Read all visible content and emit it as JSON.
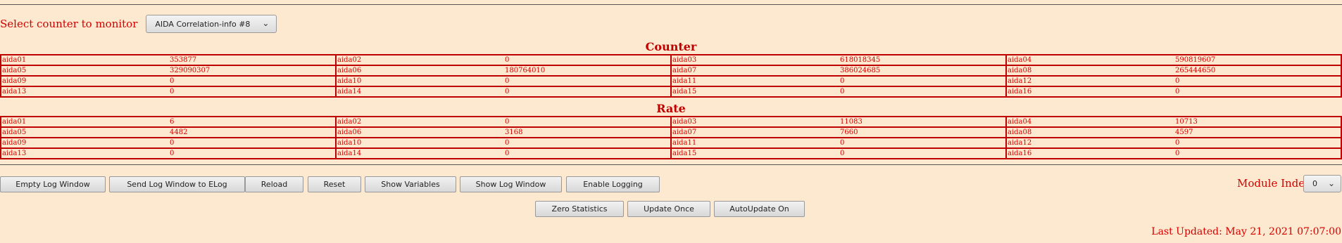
{
  "selector": {
    "label": "Select counter to monitor",
    "selected": "AIDA Correlation-info #8"
  },
  "counter": {
    "title": "Counter",
    "rows": [
      [
        {
          "name": "aida01",
          "value": "353877"
        },
        {
          "name": "aida02",
          "value": "0"
        },
        {
          "name": "aida03",
          "value": "618018345"
        },
        {
          "name": "aida04",
          "value": "590819607"
        }
      ],
      [
        {
          "name": "aida05",
          "value": "329090307"
        },
        {
          "name": "aida06",
          "value": "180764010"
        },
        {
          "name": "aida07",
          "value": "386024685"
        },
        {
          "name": "aida08",
          "value": "265444650"
        }
      ],
      [
        {
          "name": "aida09",
          "value": "0"
        },
        {
          "name": "aida10",
          "value": "0"
        },
        {
          "name": "aida11",
          "value": "0"
        },
        {
          "name": "aida12",
          "value": "0"
        }
      ],
      [
        {
          "name": "aida13",
          "value": "0"
        },
        {
          "name": "aida14",
          "value": "0"
        },
        {
          "name": "aida15",
          "value": "0"
        },
        {
          "name": "aida16",
          "value": "0"
        }
      ]
    ]
  },
  "rate": {
    "title": "Rate",
    "rows": [
      [
        {
          "name": "aida01",
          "value": "6"
        },
        {
          "name": "aida02",
          "value": "0"
        },
        {
          "name": "aida03",
          "value": "11083"
        },
        {
          "name": "aida04",
          "value": "10713"
        }
      ],
      [
        {
          "name": "aida05",
          "value": "4482"
        },
        {
          "name": "aida06",
          "value": "3168"
        },
        {
          "name": "aida07",
          "value": "7660"
        },
        {
          "name": "aida08",
          "value": "4597"
        }
      ],
      [
        {
          "name": "aida09",
          "value": "0"
        },
        {
          "name": "aida10",
          "value": "0"
        },
        {
          "name": "aida11",
          "value": "0"
        },
        {
          "name": "aida12",
          "value": "0"
        }
      ],
      [
        {
          "name": "aida13",
          "value": "0"
        },
        {
          "name": "aida14",
          "value": "0"
        },
        {
          "name": "aida15",
          "value": "0"
        },
        {
          "name": "aida16",
          "value": "0"
        }
      ]
    ]
  },
  "toolbar": {
    "empty_log": "Empty Log Window",
    "send_log": "Send Log Window to ELog",
    "reload": "Reload",
    "reset": "Reset",
    "show_variables": "Show Variables",
    "show_log": "Show Log Window",
    "enable_logging": "Enable Logging"
  },
  "module": {
    "label": "Module Index",
    "selected": "0"
  },
  "actions": {
    "zero_statistics": "Zero Statistics",
    "update_once": "Update Once",
    "autoupdate": "AutoUpdate On"
  },
  "status": {
    "last_updated": "Last Updated: May 21, 2021 07:07:00"
  },
  "colors": {
    "background": "#fde9cf",
    "text": "#d40000",
    "grid_border": "#c00000"
  }
}
